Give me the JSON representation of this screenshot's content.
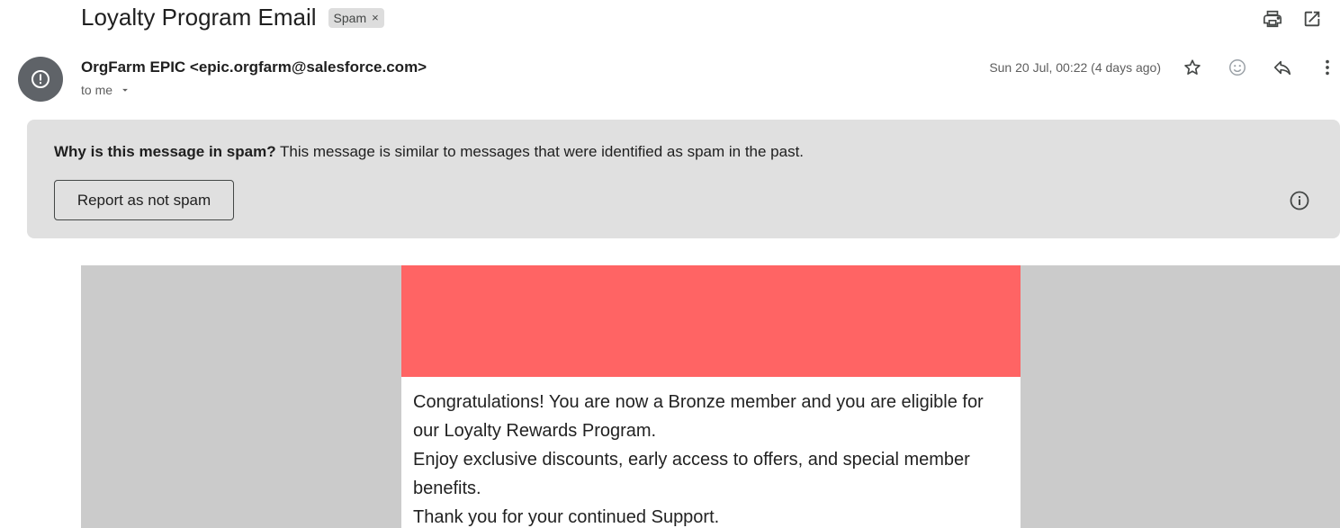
{
  "subject": "Loyalty Program Email",
  "label": {
    "text": "Spam",
    "remove": "×"
  },
  "toolbar": {
    "print_icon": "print-icon",
    "open_new_window_icon": "open-in-new-window-icon"
  },
  "sender": {
    "display": "OrgFarm EPIC <epic.orgfarm@salesforce.com>",
    "avatar_icon": "warning-icon",
    "avatar_color": "#5f6368"
  },
  "recipient": {
    "text": "to me"
  },
  "date": "Sun 20 Jul, 00:22 (4 days ago)",
  "message_actions": [
    "star-icon",
    "emoji-icon",
    "reply-icon",
    "more-options-icon"
  ],
  "spam_banner": {
    "question": "Why is this message in spam?",
    "explanation": " This message is similar to messages that were identified as spam in the past.",
    "button_label": "Report as not spam",
    "background": "#e0e0e0"
  },
  "email_content": {
    "banner_color": "#ff6464",
    "line1": "Congratulations! You are now a Bronze member and you are eligible for our Loyalty Rewards Program.",
    "line2": "Enjoy exclusive discounts, early access to offers, and special member benefits.",
    "line3": "Thank you for your continued Support."
  }
}
